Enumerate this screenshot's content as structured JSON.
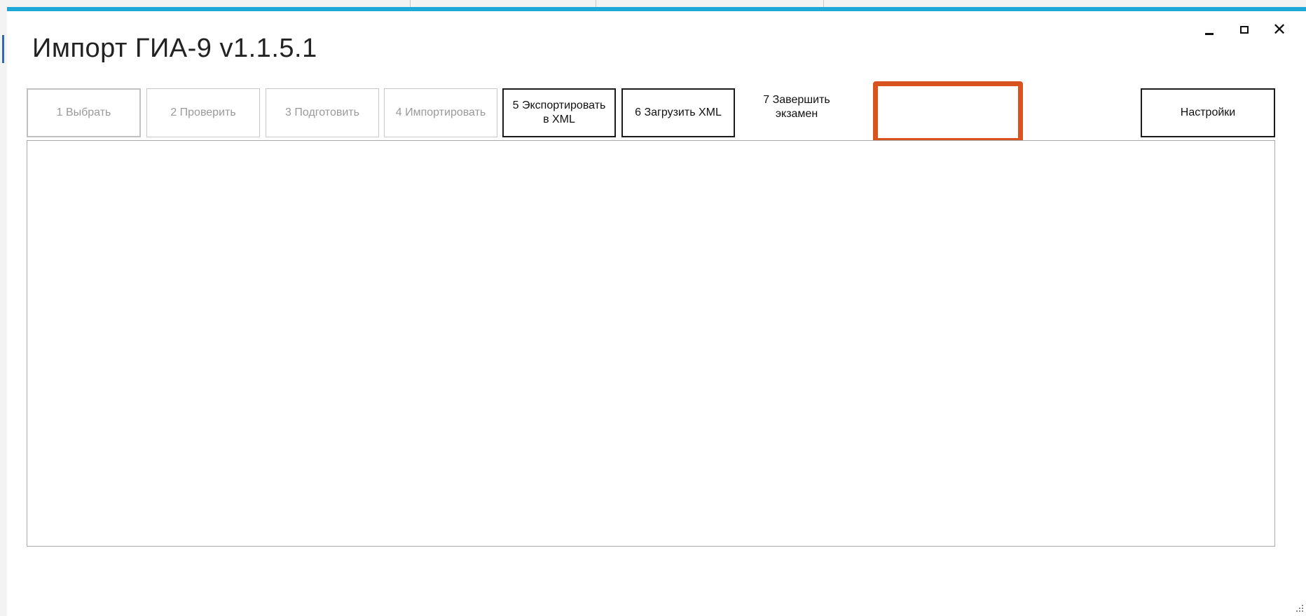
{
  "window": {
    "title": "Импорт ГИА-9 v1.1.5.1",
    "controls": {
      "minimize_icon": "minimize-icon",
      "maximize_icon": "maximize-icon",
      "close_icon": "close-icon",
      "close_glyph": "✕"
    },
    "accent_color": "#1ea8d8"
  },
  "toolbar": {
    "buttons": [
      {
        "label": "1   Выбрать",
        "enabled": false
      },
      {
        "label": "2   Проверить",
        "enabled": false
      },
      {
        "label": "3  Подготовить",
        "enabled": false
      },
      {
        "label": "4 Импортировать",
        "enabled": false
      },
      {
        "label": "5 Экспортировать\nв XML",
        "enabled": true
      },
      {
        "label": "6 Загрузить XML",
        "enabled": true
      },
      {
        "label": "7 Завершить\nэкзамен",
        "enabled": true,
        "highlighted": true
      },
      {
        "label": "Настройки",
        "enabled": true
      }
    ],
    "highlight_color": "#d9531e"
  },
  "content": {
    "empty": true
  }
}
